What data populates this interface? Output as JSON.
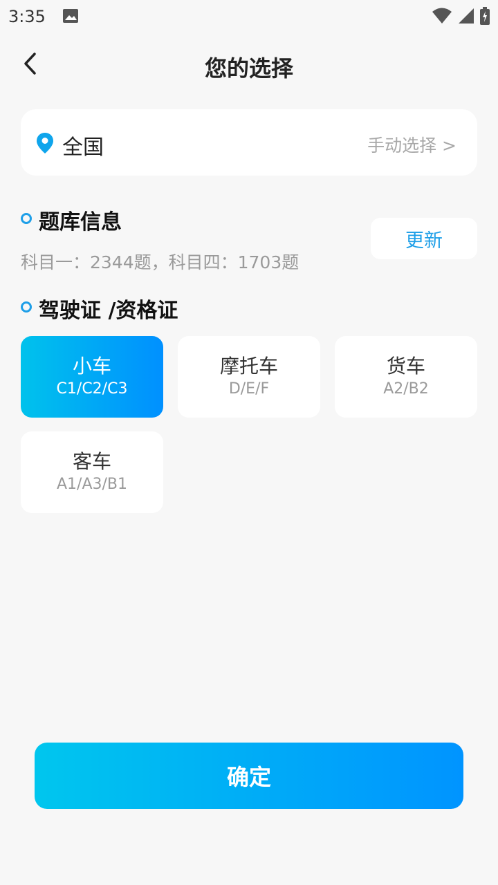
{
  "status_bar": {
    "time": "3:35"
  },
  "header": {
    "title": "您的选择"
  },
  "location": {
    "name": "全国",
    "manual_select": "手动选择 >"
  },
  "question_bank": {
    "title": "题库信息",
    "info": "科目一：2344题，科目四：1703题",
    "update_label": "更新"
  },
  "license": {
    "title": "驾驶证 /资格证",
    "options": [
      {
        "name": "小车",
        "codes": "C1/C2/C3",
        "selected": true
      },
      {
        "name": "摩托车",
        "codes": "D/E/F",
        "selected": false
      },
      {
        "name": "货车",
        "codes": "A2/B2",
        "selected": false
      },
      {
        "name": "客车",
        "codes": "A1/A3/B1",
        "selected": false
      }
    ]
  },
  "confirm_label": "确定",
  "colors": {
    "accent": "#1e9fe8",
    "gradient_start": "#00c2ec",
    "gradient_end": "#0090ff"
  },
  "icons": [
    "image-icon",
    "wifi-icon",
    "signal-icon",
    "battery-icon",
    "back-arrow-icon",
    "location-pin-icon"
  ]
}
